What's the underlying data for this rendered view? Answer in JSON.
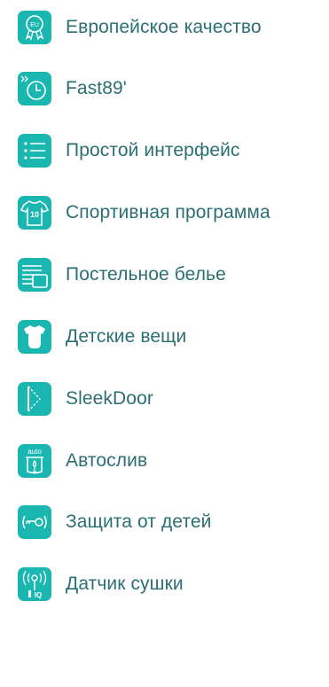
{
  "accent_color": "#1ab7b0",
  "text_color": "#2b6f74",
  "features": [
    {
      "label": "Европейское качество",
      "icon": "eu-quality-badge-icon"
    },
    {
      "label": "Fast89'",
      "icon": "fast-clock-icon"
    },
    {
      "label": "Простой интерфейс",
      "icon": "list-menu-icon"
    },
    {
      "label": "Спортивная программа",
      "icon": "sports-jersey-icon"
    },
    {
      "label": "Постельное белье",
      "icon": "bed-linen-icon"
    },
    {
      "label": "Детские вещи",
      "icon": "baby-bodysuit-icon"
    },
    {
      "label": "SleekDoor",
      "icon": "sleek-door-icon"
    },
    {
      "label": "Автослив",
      "icon": "auto-drain-icon",
      "icon_text": "auto"
    },
    {
      "label": "Защита от детей",
      "icon": "child-lock-key-icon"
    },
    {
      "label": "Датчик сушки",
      "icon": "drying-sensor-icon",
      "icon_text": "IQ"
    }
  ]
}
